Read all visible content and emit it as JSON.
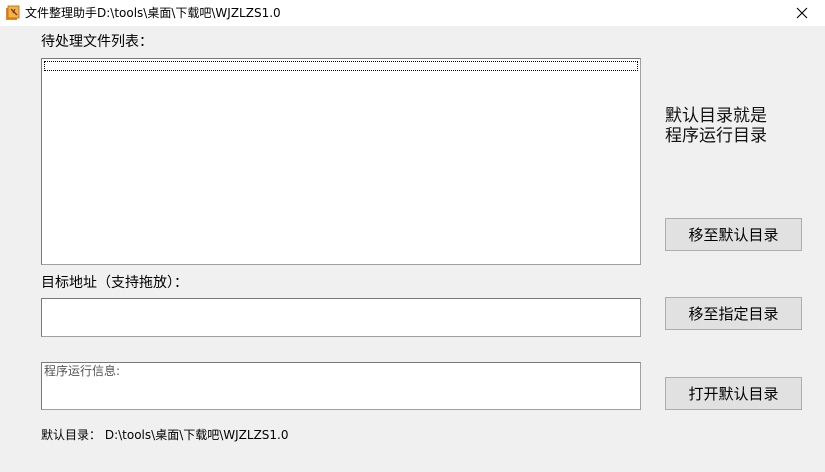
{
  "window": {
    "title": "文件整理助手D:\\tools\\桌面\\下载吧\\WJZLZS1.0",
    "close_glyph": "✕"
  },
  "file_list": {
    "label": "待处理文件列表："
  },
  "target": {
    "label": "目标地址（支持拖放）：",
    "value": ""
  },
  "info": {
    "label": "程序运行信息:"
  },
  "note": {
    "line1": "默认目录就是",
    "line2": "程序运行目录"
  },
  "buttons": {
    "move_default": "移至默认目录",
    "move_target": "移至指定目录",
    "open_default": "打开默认目录"
  },
  "status": {
    "label": "默认目录：",
    "path": "D:\\tools\\桌面\\下载吧\\WJZLZS1.0"
  },
  "icons": {
    "app": "app-icon",
    "close": "close-icon"
  },
  "colors": {
    "window_bg": "#f0f0f0",
    "app_icon_orange": "#e8891f"
  }
}
